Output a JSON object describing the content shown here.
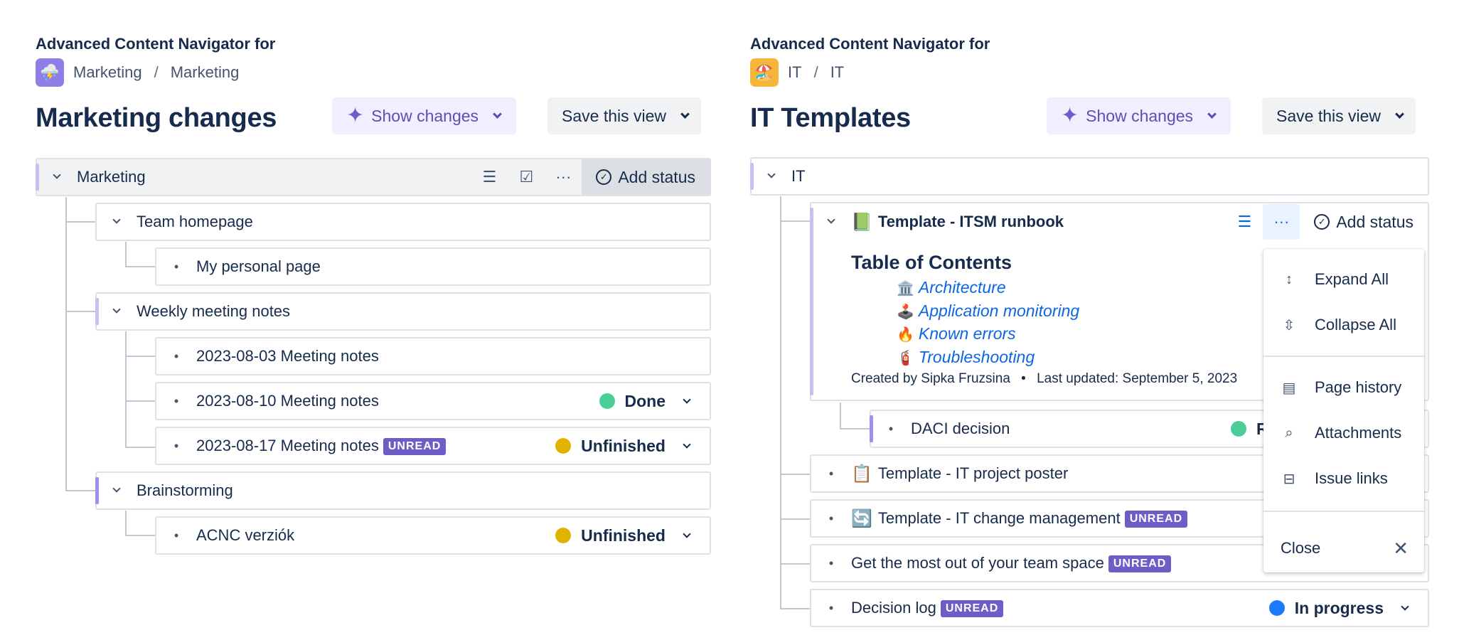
{
  "left": {
    "nav_title": "Advanced Content Navigator for",
    "space_icon": "⛈️",
    "breadcrumb": [
      "Marketing",
      "Marketing"
    ],
    "page_title": "Marketing changes",
    "show_changes": "Show changes",
    "save_view": "Save this view",
    "root": {
      "label": "Marketing",
      "add_status": "Add status"
    },
    "rows": [
      {
        "label": "Team homepage"
      },
      {
        "label": "My personal page"
      },
      {
        "label": "Weekly meeting notes"
      },
      {
        "label": "2023-08-03 Meeting notes"
      },
      {
        "label": "2023-08-10 Meeting notes",
        "status": "Done"
      },
      {
        "label": "2023-08-17 Meeting notes",
        "badge": "UNREAD",
        "status": "Unfinished"
      },
      {
        "label": "Brainstorming"
      },
      {
        "label": "ACNC verziók",
        "status": "Unfinished"
      }
    ]
  },
  "right": {
    "nav_title": "Advanced Content Navigator for",
    "space_icon": "🏖️",
    "breadcrumb": [
      "IT",
      "IT"
    ],
    "page_title": "IT Templates",
    "show_changes": "Show changes",
    "save_view": "Save this view",
    "root": {
      "label": "IT"
    },
    "expanded": {
      "icon": "📗",
      "label": "Template - ITSM runbook",
      "add_status": "Add status",
      "toc_title": "Table of Contents",
      "toc": [
        {
          "icon": "🏛️",
          "label": "Architecture"
        },
        {
          "icon": "🕹️",
          "label": "Application monitoring"
        },
        {
          "icon": "🔥",
          "label": "Known errors"
        },
        {
          "icon": "🧯",
          "label": "Troubleshooting"
        }
      ],
      "created_by": "Created by Sipka Fruzsina",
      "last_updated": "Last updated: September 5, 2023"
    },
    "rows": [
      {
        "label": "DACI decision",
        "status": "R"
      },
      {
        "icon": "📋",
        "label": "Template - IT project poster"
      },
      {
        "icon": "🔄",
        "label": "Template - IT change management",
        "badge": "UNREAD"
      },
      {
        "label": "Get the most out of your team space",
        "badge": "UNREAD"
      },
      {
        "label": "Decision log",
        "badge": "UNREAD",
        "status": "In progress"
      }
    ]
  },
  "menu": {
    "items": [
      {
        "icon": "expand-all-icon",
        "label": "Expand All"
      },
      {
        "icon": "collapse-all-icon",
        "label": "Collapse All"
      },
      {
        "icon": "page-history-icon",
        "label": "Page history"
      },
      {
        "icon": "attachment-icon",
        "label": "Attachments"
      },
      {
        "icon": "issue-links-icon",
        "label": "Issue links"
      }
    ],
    "close": "Close"
  },
  "colors": {
    "done": "#4bce97",
    "unfinished": "#e2b203",
    "in_progress": "#1d7afc",
    "badge": "#6e5dc6",
    "link": "#0c66e4"
  }
}
